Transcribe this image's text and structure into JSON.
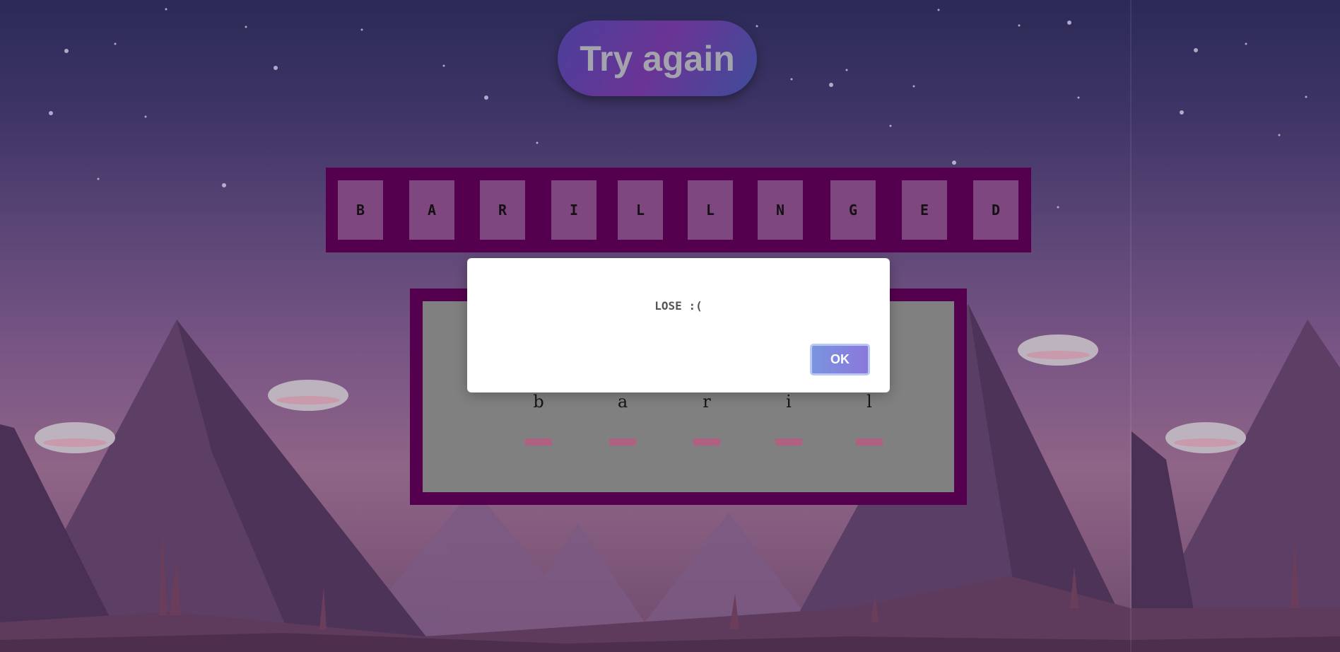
{
  "game": {
    "try_again_label": "Try again",
    "target_word": [
      "B",
      "A",
      "R",
      "I",
      "L",
      "L",
      "N",
      "G",
      "E",
      "D"
    ],
    "guessed_letters": [
      "b",
      "a",
      "r",
      "i",
      "l"
    ]
  },
  "dialog": {
    "message": "LOSE :(",
    "ok_label": "OK"
  },
  "colors": {
    "board": "#55004f",
    "guess_area": "#808080",
    "dash": "#b06080",
    "ok_button": "#7a94df"
  },
  "icons": [
    "star-icon",
    "cloud-icon",
    "mountain-icon"
  ]
}
